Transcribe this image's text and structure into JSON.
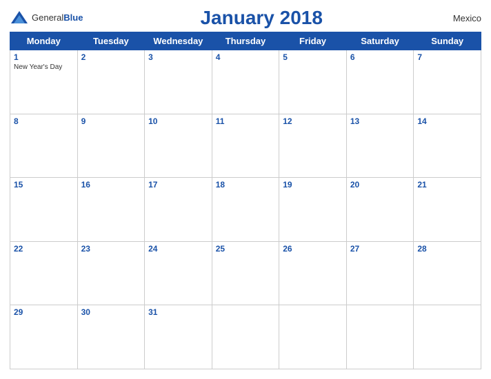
{
  "header": {
    "logo_general": "General",
    "logo_blue": "Blue",
    "title": "January 2018",
    "country": "Mexico"
  },
  "days_of_week": [
    "Monday",
    "Tuesday",
    "Wednesday",
    "Thursday",
    "Friday",
    "Saturday",
    "Sunday"
  ],
  "weeks": [
    [
      {
        "day": "1",
        "holiday": "New Year's Day"
      },
      {
        "day": "2",
        "holiday": ""
      },
      {
        "day": "3",
        "holiday": ""
      },
      {
        "day": "4",
        "holiday": ""
      },
      {
        "day": "5",
        "holiday": ""
      },
      {
        "day": "6",
        "holiday": ""
      },
      {
        "day": "7",
        "holiday": ""
      }
    ],
    [
      {
        "day": "8",
        "holiday": ""
      },
      {
        "day": "9",
        "holiday": ""
      },
      {
        "day": "10",
        "holiday": ""
      },
      {
        "day": "11",
        "holiday": ""
      },
      {
        "day": "12",
        "holiday": ""
      },
      {
        "day": "13",
        "holiday": ""
      },
      {
        "day": "14",
        "holiday": ""
      }
    ],
    [
      {
        "day": "15",
        "holiday": ""
      },
      {
        "day": "16",
        "holiday": ""
      },
      {
        "day": "17",
        "holiday": ""
      },
      {
        "day": "18",
        "holiday": ""
      },
      {
        "day": "19",
        "holiday": ""
      },
      {
        "day": "20",
        "holiday": ""
      },
      {
        "day": "21",
        "holiday": ""
      }
    ],
    [
      {
        "day": "22",
        "holiday": ""
      },
      {
        "day": "23",
        "holiday": ""
      },
      {
        "day": "24",
        "holiday": ""
      },
      {
        "day": "25",
        "holiday": ""
      },
      {
        "day": "26",
        "holiday": ""
      },
      {
        "day": "27",
        "holiday": ""
      },
      {
        "day": "28",
        "holiday": ""
      }
    ],
    [
      {
        "day": "29",
        "holiday": ""
      },
      {
        "day": "30",
        "holiday": ""
      },
      {
        "day": "31",
        "holiday": ""
      },
      {
        "day": "",
        "holiday": ""
      },
      {
        "day": "",
        "holiday": ""
      },
      {
        "day": "",
        "holiday": ""
      },
      {
        "day": "",
        "holiday": ""
      }
    ]
  ]
}
